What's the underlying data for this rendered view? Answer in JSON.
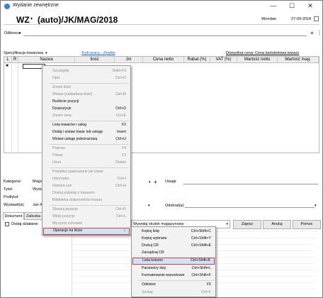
{
  "window": {
    "title": "Wydanie zewnętrzne",
    "minimize": "—",
    "maximize": "☐",
    "close": "✕"
  },
  "header": {
    "doc_type": "WZ",
    "doc_number": "(auto)/JK/MAG/2018",
    "city": "Wrocław",
    "date": "27-09-2018"
  },
  "recipient": {
    "label": "Odbiorca"
  },
  "spec": {
    "label": "Specyfikacja towarowa",
    "work_mode": "Tryb pracy - Zwykły",
    "default_price": "Domyślna cena: Cena kartotekowa towaru"
  },
  "grid": {
    "columns": [
      "L",
      "R",
      "Nazwa",
      "Ilość",
      "Jm",
      "Cena netto",
      "Rabat (%)",
      "VAT (%)",
      "Wartość netto",
      "Wartość mag."
    ],
    "row_marker": "✱"
  },
  "context_menu": {
    "items": [
      {
        "label": "Szczegóły",
        "shortcut": "Shift+F3",
        "enabled": false
      },
      {
        "label": "Opis",
        "shortcut": "Ctrl+O",
        "enabled": false
      },
      {
        "label": "Zmień ilość",
        "shortcut": "",
        "enabled": false
      },
      {
        "label": "Wstaw (nakładana ilość)",
        "shortcut": "Ctrl+M",
        "enabled": false
      },
      {
        "label": "Rozbicie pozycji",
        "shortcut": "",
        "enabled": true
      },
      {
        "label": "Dyspozycje",
        "shortcut": "Ctrl+D",
        "enabled": true
      },
      {
        "label": "Zmień cenę",
        "shortcut": "Ctrl+E",
        "enabled": false
      },
      {
        "label": "Lista towarów i usług",
        "shortcut": "F2",
        "enabled": true
      },
      {
        "label": "Dodaj i wstaw towar lub usługę",
        "shortcut": "Insert",
        "enabled": true
      },
      {
        "label": "Wstaw usługę jednorazową",
        "shortcut": "Ctrl+U",
        "enabled": true
      },
      {
        "label": "Popraw",
        "shortcut": "F4",
        "enabled": false
      },
      {
        "label": "Pokaż",
        "shortcut": "F3",
        "enabled": false
      },
      {
        "label": "Usuń",
        "shortcut": "Delete",
        "enabled": false
      },
      {
        "label": "Potraktuj opakowanie jak towar",
        "shortcut": "",
        "enabled": false
      },
      {
        "label": "Informator",
        "shortcut": "Ctrl+I",
        "enabled": false
      },
      {
        "label": "Historia cen",
        "shortcut": "Ctrl+H",
        "enabled": false
      },
      {
        "label": "Drukuj etykietę z towarem",
        "shortcut": "",
        "enabled": false
      },
      {
        "label": "Biblioteka dokumentów towaru",
        "shortcut": "",
        "enabled": false
      },
      {
        "label": "Skopiuj pozycje",
        "shortcut": "Ctrl+R",
        "enabled": false
      },
      {
        "label": "Wklej pozycje",
        "shortcut": "Ctrl+L",
        "enabled": false
      },
      {
        "label": "Wyczyść schowek",
        "shortcut": "",
        "enabled": false
      },
      {
        "label": "Operacje na liście",
        "shortcut": "",
        "enabled": true
      }
    ]
  },
  "submenu": {
    "items": [
      {
        "label": "Kopiuj listę",
        "shortcut": "Ctrl+Shift+C"
      },
      {
        "label": "Kopiuj wybrane",
        "shortcut": "Ctrl+Shift+Y"
      },
      {
        "label": "Drukuj CR",
        "shortcut": "Ctrl+Shift+E"
      },
      {
        "label": "Zarządzaj CR",
        "shortcut": ""
      },
      {
        "label": "Lista kolumn",
        "shortcut": "Ctrl+Shift+K"
      },
      {
        "label": "Parametry listy",
        "shortcut": "Ctrl+Shift+L"
      },
      {
        "label": "Formatowanie warunkowe",
        "shortcut": "Ctrl+Shift+F"
      },
      {
        "label": "Odśwież",
        "shortcut": "F5"
      },
      {
        "label": "Szukaj",
        "shortcut": "Ctrl+F"
      }
    ]
  },
  "form": {
    "category_label": "Kategoria:",
    "category_value": "Maga",
    "title_label": "Tytuł:",
    "title_value": "Wyda",
    "signature_label": "Podtytuł:",
    "issuer_label": "Wystawił(a):",
    "issuer_value": "Jan K",
    "notes_label": "Uwagi:",
    "receiver_label": "Odebrał(a):",
    "effect_value": "Wywołaj skutek magazynowy"
  },
  "tabs": {
    "document": "Dokument",
    "advance": "Zaliczka"
  },
  "footer": {
    "add_action": "Dodaj działanie",
    "save": "Zapisz",
    "cancel": "Anuluj",
    "help": "Pomoc"
  },
  "colors": {
    "highlight_border": "#d9393f",
    "highlight_fill": "#cfe3f7",
    "link": "#1f5fbf"
  }
}
